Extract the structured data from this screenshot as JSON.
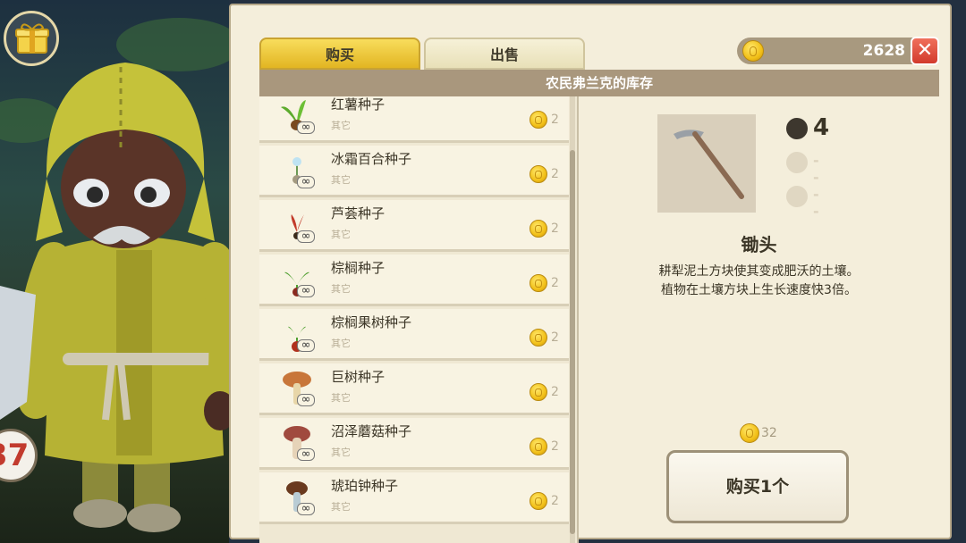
{
  "scene": {
    "level_badge": "37"
  },
  "tabs": [
    {
      "label": "购买",
      "active": true
    },
    {
      "label": "出售",
      "active": false
    }
  ],
  "currency": {
    "amount": "2628"
  },
  "shop": {
    "title": "农民弗兰克的库存"
  },
  "items": [
    {
      "name": "红薯种子",
      "category": "其它",
      "price": "2",
      "icon": "sweet-potato-seed-icon"
    },
    {
      "name": "冰霜百合种子",
      "category": "其它",
      "price": "2",
      "icon": "frost-lily-seed-icon"
    },
    {
      "name": "芦荟种子",
      "category": "其它",
      "price": "2",
      "icon": "aloe-seed-icon"
    },
    {
      "name": "棕榈种子",
      "category": "其它",
      "price": "2",
      "icon": "palm-seed-icon"
    },
    {
      "name": "棕榈果树种子",
      "category": "其它",
      "price": "2",
      "icon": "palm-fruit-tree-seed-icon"
    },
    {
      "name": "巨树种子",
      "category": "其它",
      "price": "2",
      "icon": "giant-tree-seed-icon"
    },
    {
      "name": "沼泽蘑菇种子",
      "category": "其它",
      "price": "2",
      "icon": "swamp-mushroom-seed-icon"
    },
    {
      "name": "琥珀钟种子",
      "category": "其它",
      "price": "2",
      "icon": "amber-bell-seed-icon"
    }
  ],
  "detail": {
    "title": "锄头",
    "description_line1": "耕犁泥土方块使其变成肥沃的土壤。",
    "description_line2": "植物在土壤方块上生长速度快3倍。",
    "tiers": [
      {
        "value": "4",
        "active": true
      },
      {
        "value": "--",
        "active": false
      },
      {
        "value": "--",
        "active": false
      }
    ],
    "cost": "32",
    "buy_label": "购买1个"
  },
  "colors": {
    "tab_active": "#e2b522",
    "header": "#a9977d",
    "close": "#d23a2c"
  }
}
